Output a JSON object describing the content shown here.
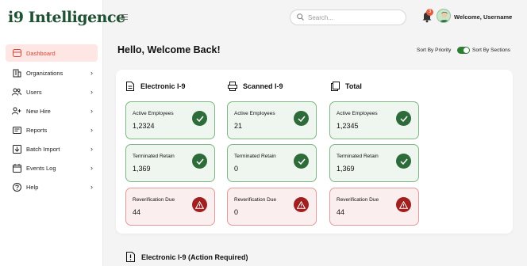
{
  "brand": {
    "prefix": "i9",
    "name": " Intelligence"
  },
  "sidebar": {
    "items": [
      {
        "label": "Dashboard",
        "icon": "dashboard-icon",
        "active": true,
        "chevron": ""
      },
      {
        "label": "Organizations",
        "icon": "building-icon",
        "chevron": "›"
      },
      {
        "label": "Users",
        "icon": "users-icon",
        "chevron": "›"
      },
      {
        "label": "New Hire",
        "icon": "user-plus-icon",
        "chevron": "›"
      },
      {
        "label": "Reports",
        "icon": "reports-icon",
        "chevron": "›"
      },
      {
        "label": "Batch Import",
        "icon": "import-icon",
        "chevron": "›"
      },
      {
        "label": "Events Log",
        "icon": "calendar-icon",
        "chevron": "›"
      },
      {
        "label": "Help",
        "icon": "help-icon",
        "chevron": "›"
      }
    ]
  },
  "header": {
    "search_placeholder": "Search...",
    "notification_count": "3",
    "welcome": "Welcome, Username",
    "chevron": "⌄"
  },
  "main": {
    "greeting": "Hello, Welcome Back!",
    "sort_left": "Sort By Priority",
    "sort_right": "Sort By Sections",
    "sort_by_sections": true,
    "columns": [
      {
        "title": "Electronic I-9",
        "icon": "document-icon",
        "cards": [
          {
            "label": "Active Employees",
            "value": "1,2324",
            "status": "ok"
          },
          {
            "label": "Terminated Retain",
            "value": "1,369",
            "status": "ok"
          },
          {
            "label": "Reverification Due",
            "value": "44",
            "status": "warn"
          }
        ]
      },
      {
        "title": "Scanned I-9",
        "icon": "scanner-icon",
        "cards": [
          {
            "label": "Active Employees",
            "value": "21",
            "status": "ok"
          },
          {
            "label": "Terminated Retain",
            "value": "0",
            "status": "ok"
          },
          {
            "label": "Reverification Due",
            "value": "0",
            "status": "warn"
          }
        ]
      },
      {
        "title": "Total",
        "icon": "copy-icon",
        "cards": [
          {
            "label": "Active Employees",
            "value": "1,2345",
            "status": "ok"
          },
          {
            "label": "Terminated Retain",
            "value": "1,369",
            "status": "ok"
          },
          {
            "label": "Reverification Due",
            "value": "44",
            "status": "warn"
          }
        ]
      }
    ],
    "action_required_title": "Electronic I-9 (Action Required)"
  },
  "colors": {
    "brand_green": "#1f5132",
    "active_bg": "#fde6e3",
    "active_text": "#d4473b",
    "ok_bg": "#eef6ef",
    "ok_border": "#7fb685",
    "ok_badge": "#2e6b3a",
    "warn_bg": "#fbeeee",
    "warn_border": "#e39a9a",
    "warn_badge": "#a11f1f",
    "toggle_on": "#2e7d32"
  }
}
